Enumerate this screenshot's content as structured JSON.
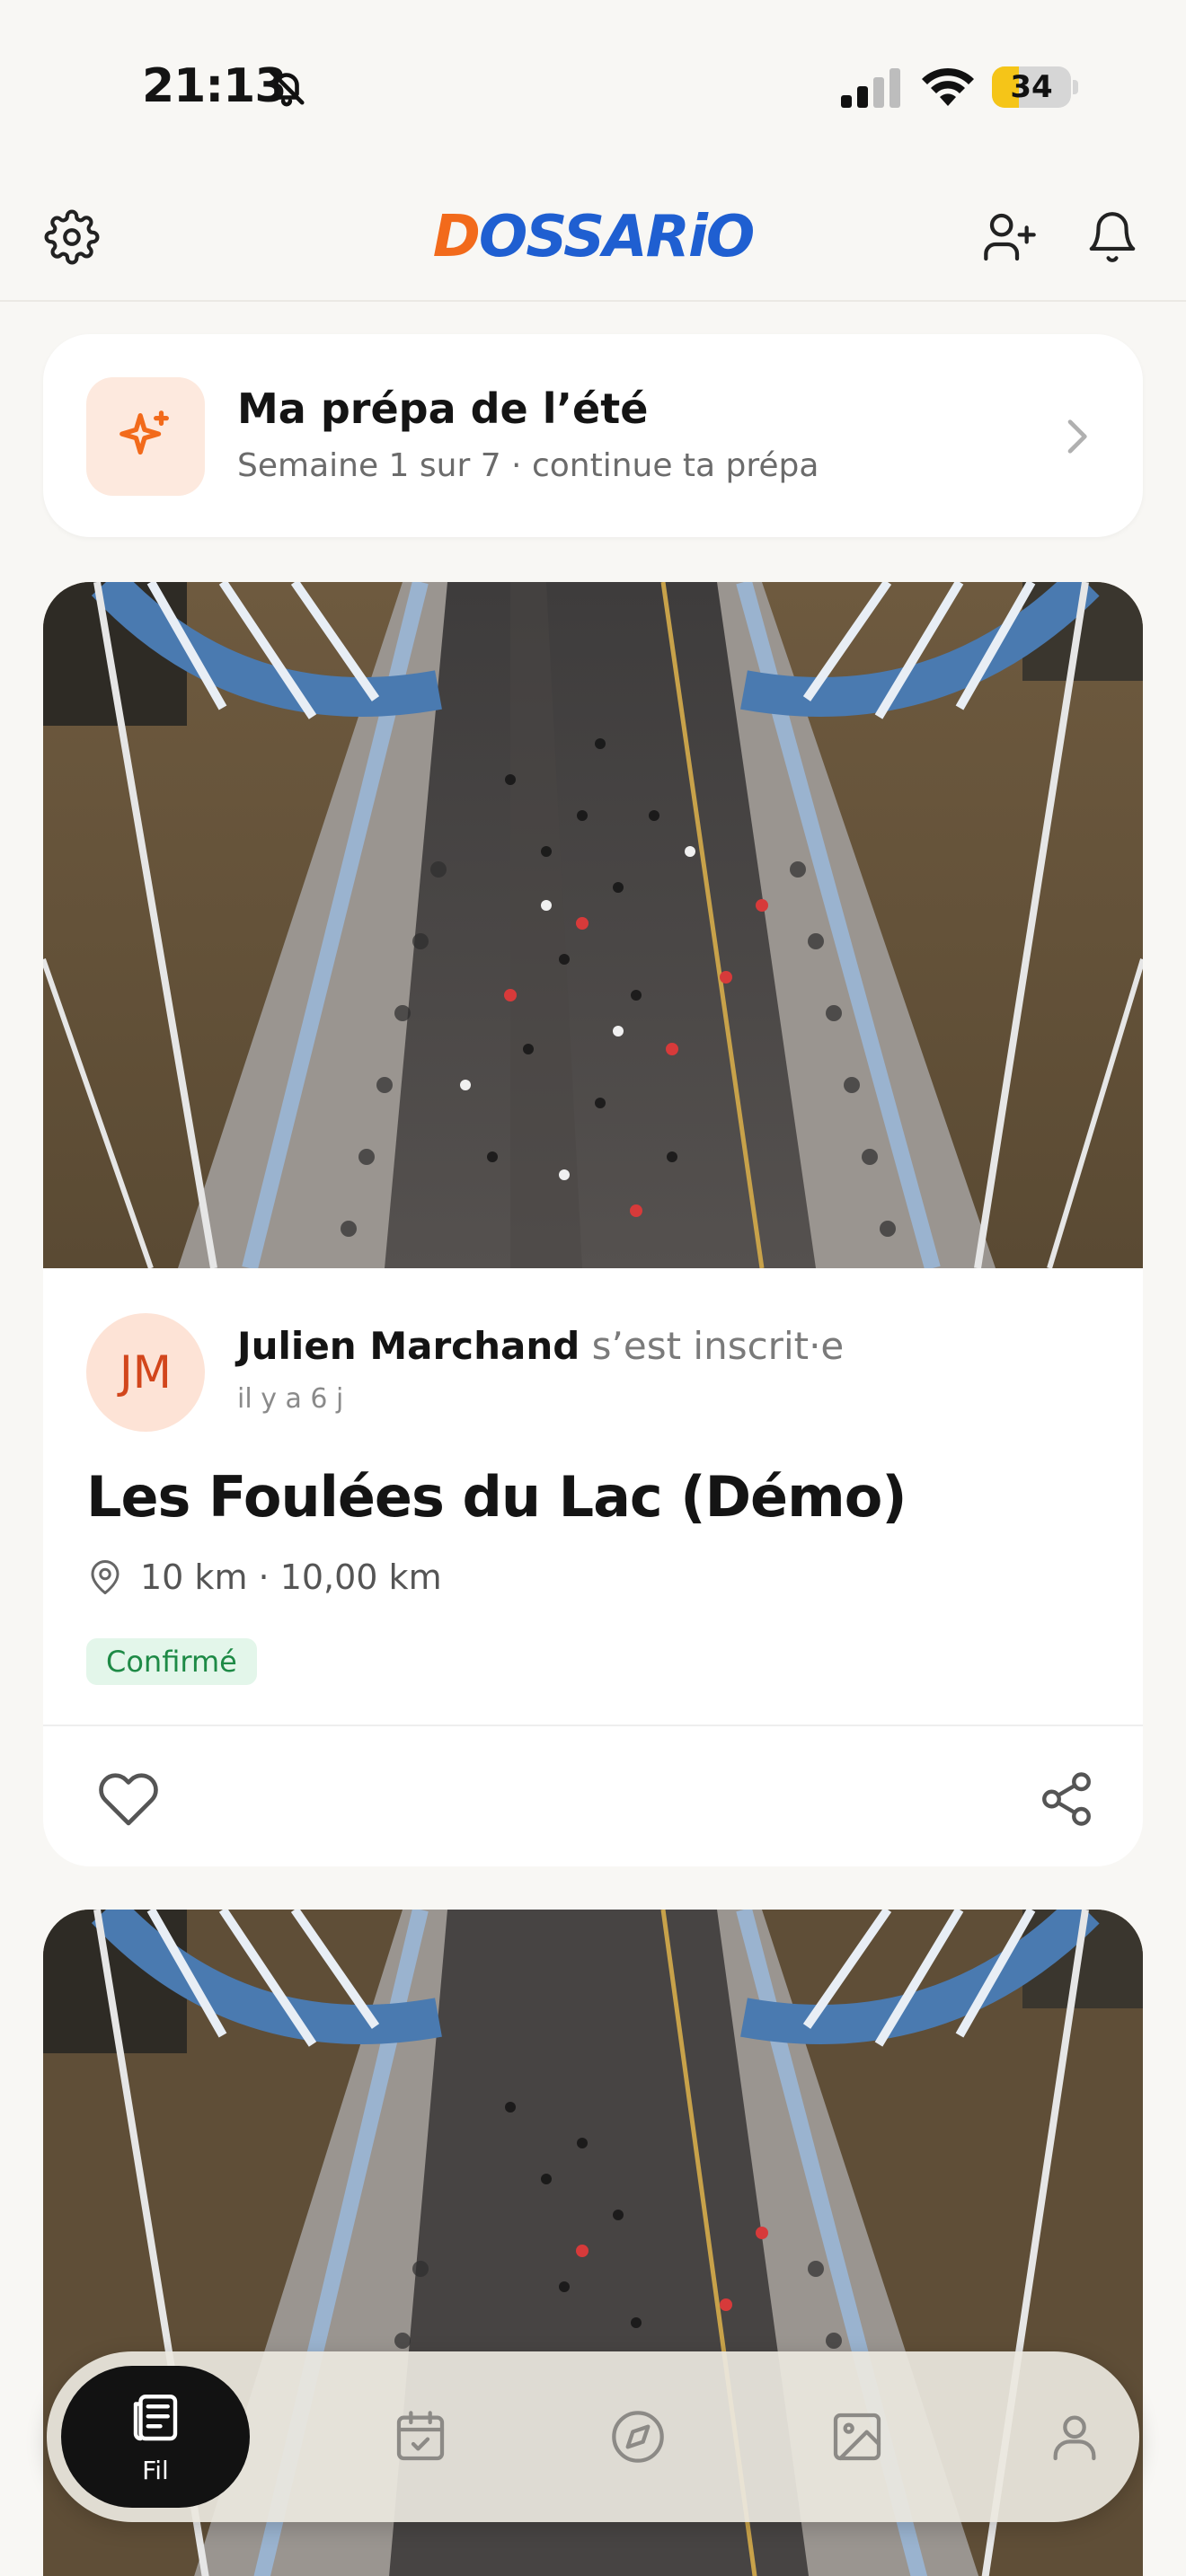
{
  "status_bar": {
    "time": "21:13",
    "battery_percent": 34,
    "battery_label": "34",
    "icons": [
      "bell-off-icon",
      "cellular-signal-icon",
      "wifi-icon",
      "battery-icon"
    ]
  },
  "header": {
    "logo_prefix": "D",
    "logo_rest": "OSSARiO",
    "icons": [
      "gear-icon",
      "add-user-icon",
      "bell-icon"
    ],
    "colors": {
      "brand_blue": "#1f5fd1",
      "brand_orange": "#f26a1b"
    }
  },
  "prep_card": {
    "title": "Ma prépa de l’été",
    "subtitle": "Semaine 1 sur 7 · continue ta prépa",
    "icon": "sparkles-icon"
  },
  "feed": [
    {
      "avatar_initials": "JM",
      "author": "Julien Marchand",
      "action": "s’est inscrit·e",
      "time": "il y a 6 j",
      "race_title": "Les Foulées du Lac (Démo)",
      "location": "10 km · 10,00 km",
      "status": "Confirmé",
      "status_color": "#1e8a46"
    }
  ],
  "tab_bar": {
    "tabs": [
      {
        "label": "Fil",
        "icon": "news-icon",
        "active": true
      },
      {
        "label": "",
        "icon": "calendar-check-icon",
        "active": false
      },
      {
        "label": "",
        "icon": "compass-icon",
        "active": false
      },
      {
        "label": "",
        "icon": "image-icon",
        "active": false
      },
      {
        "label": "",
        "icon": "user-icon",
        "active": false
      }
    ]
  }
}
